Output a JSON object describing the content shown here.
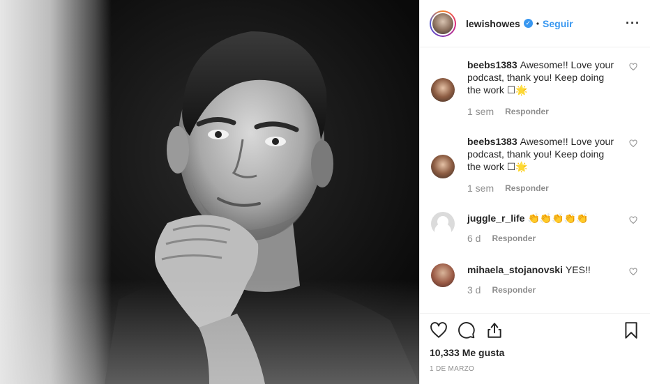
{
  "header": {
    "username": "lewishowes",
    "separator": "•",
    "follow_label": "Seguir",
    "more_label": "···"
  },
  "comments": [
    {
      "user": "beebs1383",
      "text": "Awesome!! Love your podcast, thank you! Keep doing the work ☐🌟",
      "time": "1 sem",
      "reply": "Responder"
    },
    {
      "user": "beebs1383",
      "text": "Awesome!! Love your podcast, thank you! Keep doing the work ☐🌟",
      "time": "1 sem",
      "reply": "Responder"
    },
    {
      "user": "juggle_r_life",
      "text": "👏👏👏👏👏",
      "time": "6 d",
      "reply": "Responder"
    },
    {
      "user": "mihaela_stojanovski",
      "text": "YES!!",
      "time": "3 d",
      "reply": "Responder"
    }
  ],
  "post": {
    "likes": "10,333 Me gusta",
    "date": "1 DE MARZO"
  },
  "icons": {
    "like": "heart-icon",
    "comment": "comment-icon",
    "share": "share-icon",
    "save": "bookmark-icon",
    "verified": "verified-badge-icon"
  },
  "colors": {
    "accent": "#3897f0",
    "text": "#262626",
    "muted": "#8e8e8e",
    "border": "#efefef"
  }
}
